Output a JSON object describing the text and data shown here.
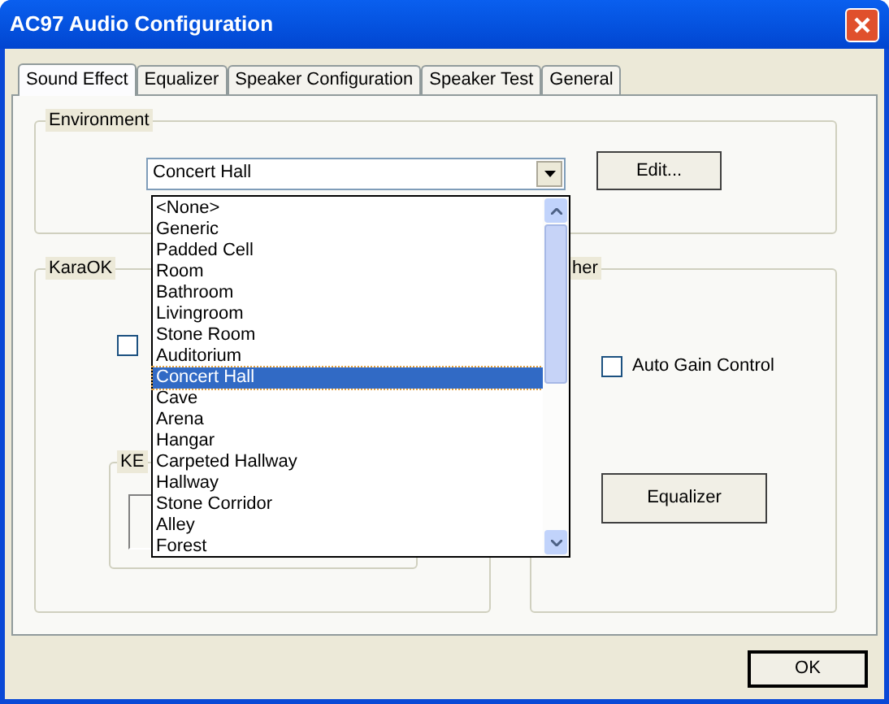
{
  "window": {
    "title": "AC97 Audio Configuration"
  },
  "tabs": [
    {
      "label": "Sound Effect",
      "selected": true
    },
    {
      "label": "Equalizer",
      "selected": false
    },
    {
      "label": "Speaker Configuration",
      "selected": false
    },
    {
      "label": "Speaker Test",
      "selected": false
    },
    {
      "label": "General",
      "selected": false
    }
  ],
  "environment": {
    "label": "Environment",
    "value": "Concert Hall",
    "edit_button": "Edit...",
    "options": [
      {
        "label": "<None>",
        "selected": false
      },
      {
        "label": "Generic",
        "selected": false
      },
      {
        "label": "Padded Cell",
        "selected": false
      },
      {
        "label": "Room",
        "selected": false
      },
      {
        "label": "Bathroom",
        "selected": false
      },
      {
        "label": "Livingroom",
        "selected": false
      },
      {
        "label": "Stone Room",
        "selected": false
      },
      {
        "label": "Auditorium",
        "selected": false
      },
      {
        "label": "Concert Hall",
        "selected": true
      },
      {
        "label": "Cave",
        "selected": false
      },
      {
        "label": "Arena",
        "selected": false
      },
      {
        "label": "Hangar",
        "selected": false
      },
      {
        "label": "Carpeted Hallway",
        "selected": false
      },
      {
        "label": "Hallway",
        "selected": false
      },
      {
        "label": "Stone Corridor",
        "selected": false
      },
      {
        "label": "Alley",
        "selected": false
      },
      {
        "label": "Forest",
        "selected": false
      }
    ]
  },
  "karaok": {
    "label": "KaraOK",
    "checkbox": {
      "checked": false
    },
    "group_label": "KE"
  },
  "other": {
    "label": "her",
    "auto_gain": {
      "label": "Auto Gain Control",
      "checked": false
    },
    "button": "Equalizer"
  },
  "ok_button": "OK"
}
